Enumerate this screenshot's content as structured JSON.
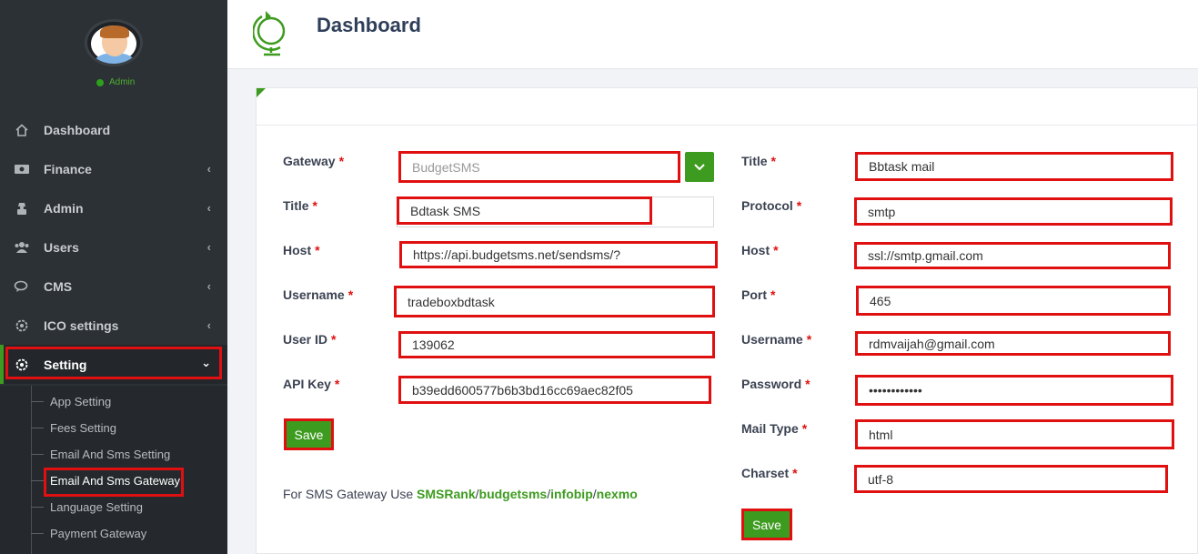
{
  "sidebar": {
    "user_status": "Admin",
    "items": [
      {
        "label": "Dashboard",
        "icon": "home-icon",
        "has_chevron": false
      },
      {
        "label": "Finance",
        "icon": "money-icon",
        "has_chevron": true
      },
      {
        "label": "Admin",
        "icon": "user-secret-icon",
        "has_chevron": true
      },
      {
        "label": "Users",
        "icon": "users-icon",
        "has_chevron": true
      },
      {
        "label": "CMS",
        "icon": "comments-icon",
        "has_chevron": true
      },
      {
        "label": "ICO settings",
        "icon": "cog-icon",
        "has_chevron": true
      },
      {
        "label": "Setting",
        "icon": "gear-icon",
        "has_chevron": true,
        "active": true
      }
    ],
    "submenu": [
      {
        "label": "App Setting"
      },
      {
        "label": "Fees Setting"
      },
      {
        "label": "Email And Sms Setting"
      },
      {
        "label": "Email And Sms Gateway",
        "active": true
      },
      {
        "label": "Language Setting"
      },
      {
        "label": "Payment Gateway"
      }
    ]
  },
  "header": {
    "title": "Dashboard"
  },
  "sms_form": {
    "gateway_label": "Gateway",
    "gateway_value": "BudgetSMS",
    "title_label": "Title",
    "title_value": "Bdtask SMS",
    "host_label": "Host",
    "host_value": "https://api.budgetsms.net/sendsms/?",
    "username_label": "Username",
    "username_value": "tradeboxbdtask",
    "userid_label": "User ID",
    "userid_value": "139062",
    "apikey_label": "API Key",
    "apikey_value": "b39edd600577b6b3bd16cc69aec82f05",
    "save_label": "Save",
    "required_mark": "*"
  },
  "email_form": {
    "title_label": "Title",
    "title_value": "Bbtask mail",
    "protocol_label": "Protocol",
    "protocol_value": "smtp",
    "host_label": "Host",
    "host_value": "ssl://smtp.gmail.com",
    "port_label": "Port",
    "port_value": "465",
    "username_label": "Username",
    "username_value": "rdmvaijah@gmail.com",
    "password_label": "Password",
    "password_value": "••••••••••••",
    "mailtype_label": "Mail Type",
    "mailtype_value": "html",
    "charset_label": "Charset",
    "charset_value": "utf-8",
    "save_label": "Save"
  },
  "note": {
    "prefix": "For SMS Gateway Use ",
    "links": [
      "SMSRank",
      "budgetsms",
      "infobip",
      "nexmo"
    ],
    "separator": "/"
  },
  "colors": {
    "accent": "#3d9b1f",
    "highlight": "#e01010",
    "sidebar_bg": "#2c3136"
  }
}
